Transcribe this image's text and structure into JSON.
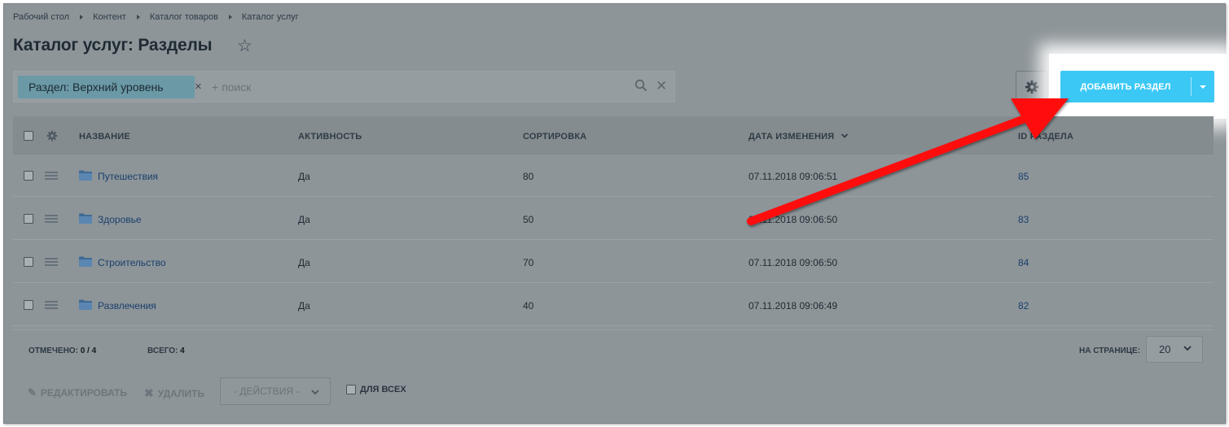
{
  "breadcrumb": [
    "Рабочий стол",
    "Контент",
    "Каталог товаров",
    "Каталог услуг"
  ],
  "page": {
    "title": "Каталог услуг: Разделы"
  },
  "filter": {
    "chip_label": "Раздел: Верхний уровень",
    "search_placeholder": "+ поиск"
  },
  "toolbar": {
    "add_button_label": "ДОБАВИТЬ РАЗДЕЛ",
    "accent_color": "#3bc8f5"
  },
  "table": {
    "columns": {
      "name": "НАЗВАНИЕ",
      "active": "АКТИВНОСТЬ",
      "sort": "СОРТИРОВКА",
      "modified": "ДАТА ИЗМЕНЕНИЯ",
      "id": "ID РАЗДЕЛА"
    },
    "sorted_by": "modified",
    "rows": [
      {
        "name": "Путешествия",
        "active": "Да",
        "sort": "80",
        "modified": "07.11.2018 09:06:51",
        "id": "85"
      },
      {
        "name": "Здоровье",
        "active": "Да",
        "sort": "50",
        "modified": "07.11.2018 09:06:50",
        "id": "83"
      },
      {
        "name": "Строительство",
        "active": "Да",
        "sort": "70",
        "modified": "07.11.2018 09:06:50",
        "id": "84"
      },
      {
        "name": "Развлечения",
        "active": "Да",
        "sort": "40",
        "modified": "07.11.2018 09:06:49",
        "id": "82"
      }
    ]
  },
  "footer": {
    "selected_label": "ОТМЕЧЕНО:",
    "selected_value": "0 / 4",
    "total_label": "ВСЕГО:",
    "total_value": "4",
    "per_page_label": "НА СТРАНИЦЕ:",
    "per_page_value": "20"
  },
  "actions": {
    "edit": "РЕДАКТИРОВАТЬ",
    "delete": "УДАЛИТЬ",
    "select_placeholder": "- ДЕЙСТВИЯ -",
    "for_all": "ДЛЯ ВСЕХ"
  },
  "annotation": {
    "arrow_color": "#ff0000",
    "icon": "red-arrow-icon"
  }
}
